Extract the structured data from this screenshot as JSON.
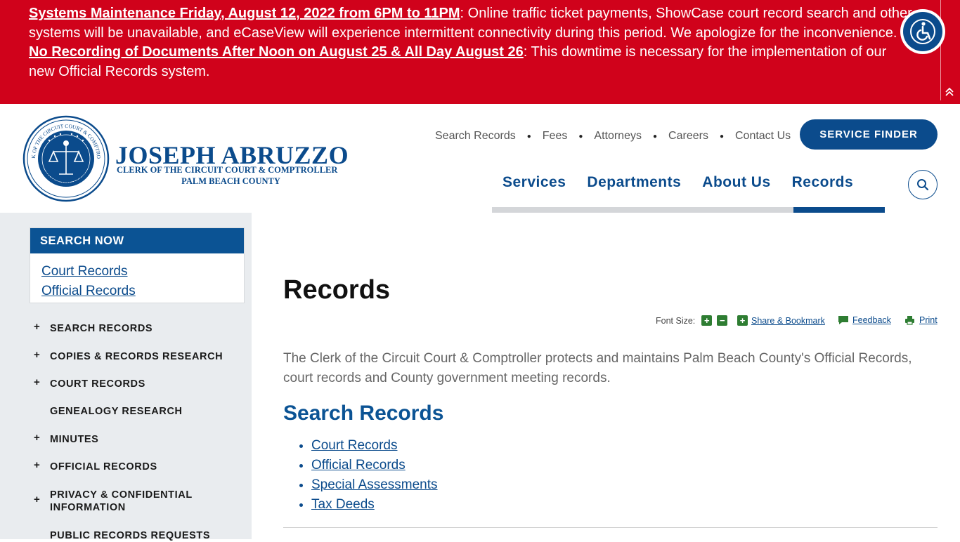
{
  "alert": {
    "msg1_link": "Systems Maintenance Friday, August 12, 2022 from 6PM to 11PM",
    "msg1_text": ": Online traffic ticket payments, ShowCase court record search and other systems will be unavailable, and eCaseView will experience intermittent connectivity during this period. We apologize for the inconvenience.",
    "msg2_link": "No Recording of Documents After Noon on August 25 & All Day August 26",
    "msg2_text": ": This downtime is necessary for the implementation of our new Official Records system.",
    "accessibility_icon": "wheelchair-accessibility-icon",
    "collapse_icon": "double-chevron-up-icon"
  },
  "header": {
    "seal_text_top": "CLERK OF THE CIRCUIT COURT & COMPTROLLER",
    "seal_text_bottom": "PALM BEACH COUNTY",
    "brand_name": "JOSEPH ABRUZZO",
    "brand_sub1": "CLERK OF THE CIRCUIT COURT & COMPTROLLER",
    "brand_sub2": "PALM BEACH COUNTY",
    "util_nav": [
      "Search Records",
      "Fees",
      "Attorneys",
      "Careers",
      "Contact Us"
    ],
    "service_finder": "SERVICE FINDER",
    "main_nav": [
      "Services",
      "Departments",
      "About Us",
      "Records"
    ],
    "active_nav": "Records",
    "search_icon": "search-icon"
  },
  "sidebar": {
    "search_now_title": "SEARCH NOW",
    "search_links": [
      "Court Records",
      "Official Records"
    ],
    "nav_items": [
      {
        "label": "SEARCH RECORDS",
        "expandable": true
      },
      {
        "label": "COPIES & RECORDS RESEARCH",
        "expandable": true
      },
      {
        "label": "COURT RECORDS",
        "expandable": true
      },
      {
        "label": "GENEALOGY RESEARCH",
        "expandable": false
      },
      {
        "label": "MINUTES",
        "expandable": true
      },
      {
        "label": "OFFICIAL RECORDS",
        "expandable": true
      },
      {
        "label": "PRIVACY & CONFIDENTIAL INFORMATION",
        "expandable": true
      },
      {
        "label": "PUBLIC RECORDS REQUESTS",
        "expandable": false
      }
    ]
  },
  "content": {
    "title": "Records",
    "tools": {
      "font_size_label": "Font Size:",
      "increase": "+",
      "decrease": "−",
      "share": "Share & Bookmark",
      "feedback": "Feedback",
      "print": "Print"
    },
    "intro": "The Clerk of the Circuit Court & Comptroller protects and maintains Palm Beach County's Official Records, court records and County government meeting records.",
    "section_title": "Search Records",
    "links": [
      "Court Records",
      "Official Records",
      "Special Assessments",
      "Tax Deeds"
    ]
  },
  "colors": {
    "alert_red": "#d0021b",
    "brand_blue": "#0b4b8c",
    "tool_green": "#2e7d32",
    "sidebar_bg": "#e9ecef"
  }
}
